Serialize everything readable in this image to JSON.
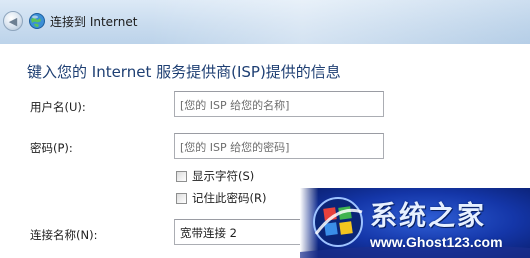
{
  "window": {
    "title": "连接到 Internet",
    "back_icon": "back-arrow-icon",
    "app_icon": "network-globe-icon"
  },
  "page": {
    "heading": "键入您的 Internet 服务提供商(ISP)提供的信息"
  },
  "form": {
    "username": {
      "label": "用户名(U):",
      "placeholder": "[您的 ISP 给您的名称]"
    },
    "password": {
      "label": "密码(P):",
      "placeholder": "[您的 ISP 给您的密码]"
    },
    "show_chars": {
      "label": "显示字符(S)",
      "checked": false
    },
    "remember_password": {
      "label": "记住此密码(R)",
      "checked": false
    },
    "connection_name": {
      "label": "连接名称(N):",
      "value": "宽带连接 2"
    }
  },
  "watermark": {
    "title": "系统之家",
    "url": "www.Ghost123.com"
  },
  "colors": {
    "heading": "#1e3f73",
    "titlebar": "#c9dcef",
    "field_border": "#abadb3"
  }
}
